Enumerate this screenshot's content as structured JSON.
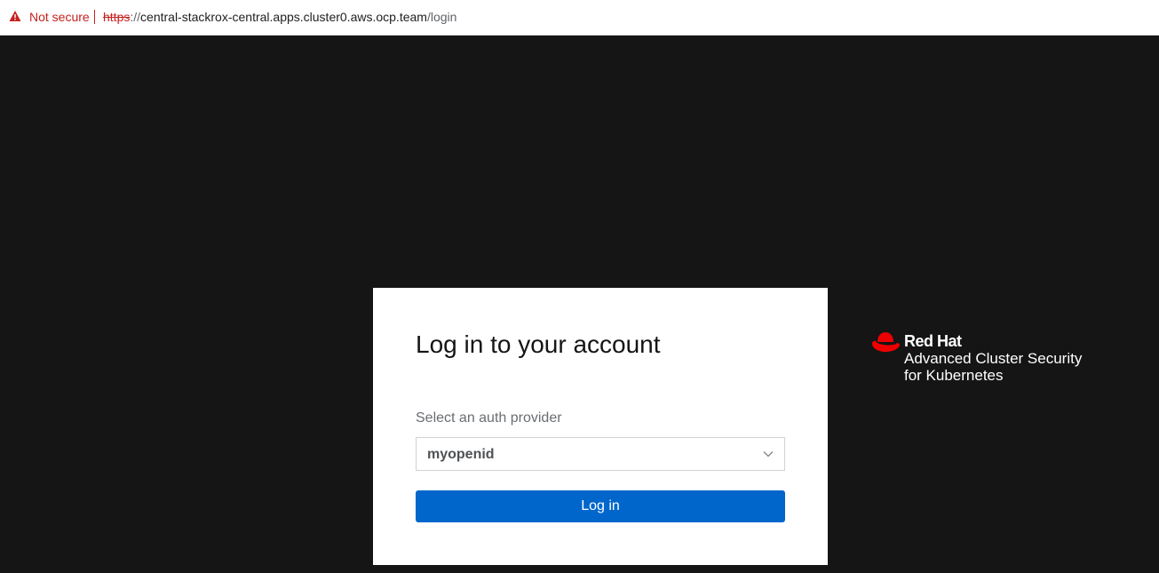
{
  "browser": {
    "security_label": "Not secure",
    "url_scheme": "https",
    "url_separator": "://",
    "url_host": "central-stackrox-central.apps.cluster0.aws.ocp.team",
    "url_path": "/login",
    "warning_color": "#c5221f"
  },
  "login": {
    "title": "Log in to your account",
    "provider_label": "Select an auth provider",
    "provider_value": "myopenid",
    "login_button": "Log in",
    "button_color": "#0066cc"
  },
  "brand": {
    "logo_icon": "red-hat-icon",
    "name": "Red Hat",
    "product": "Advanced Cluster Security",
    "subtitle": "for Kubernetes",
    "accent_color": "#ee0000"
  }
}
